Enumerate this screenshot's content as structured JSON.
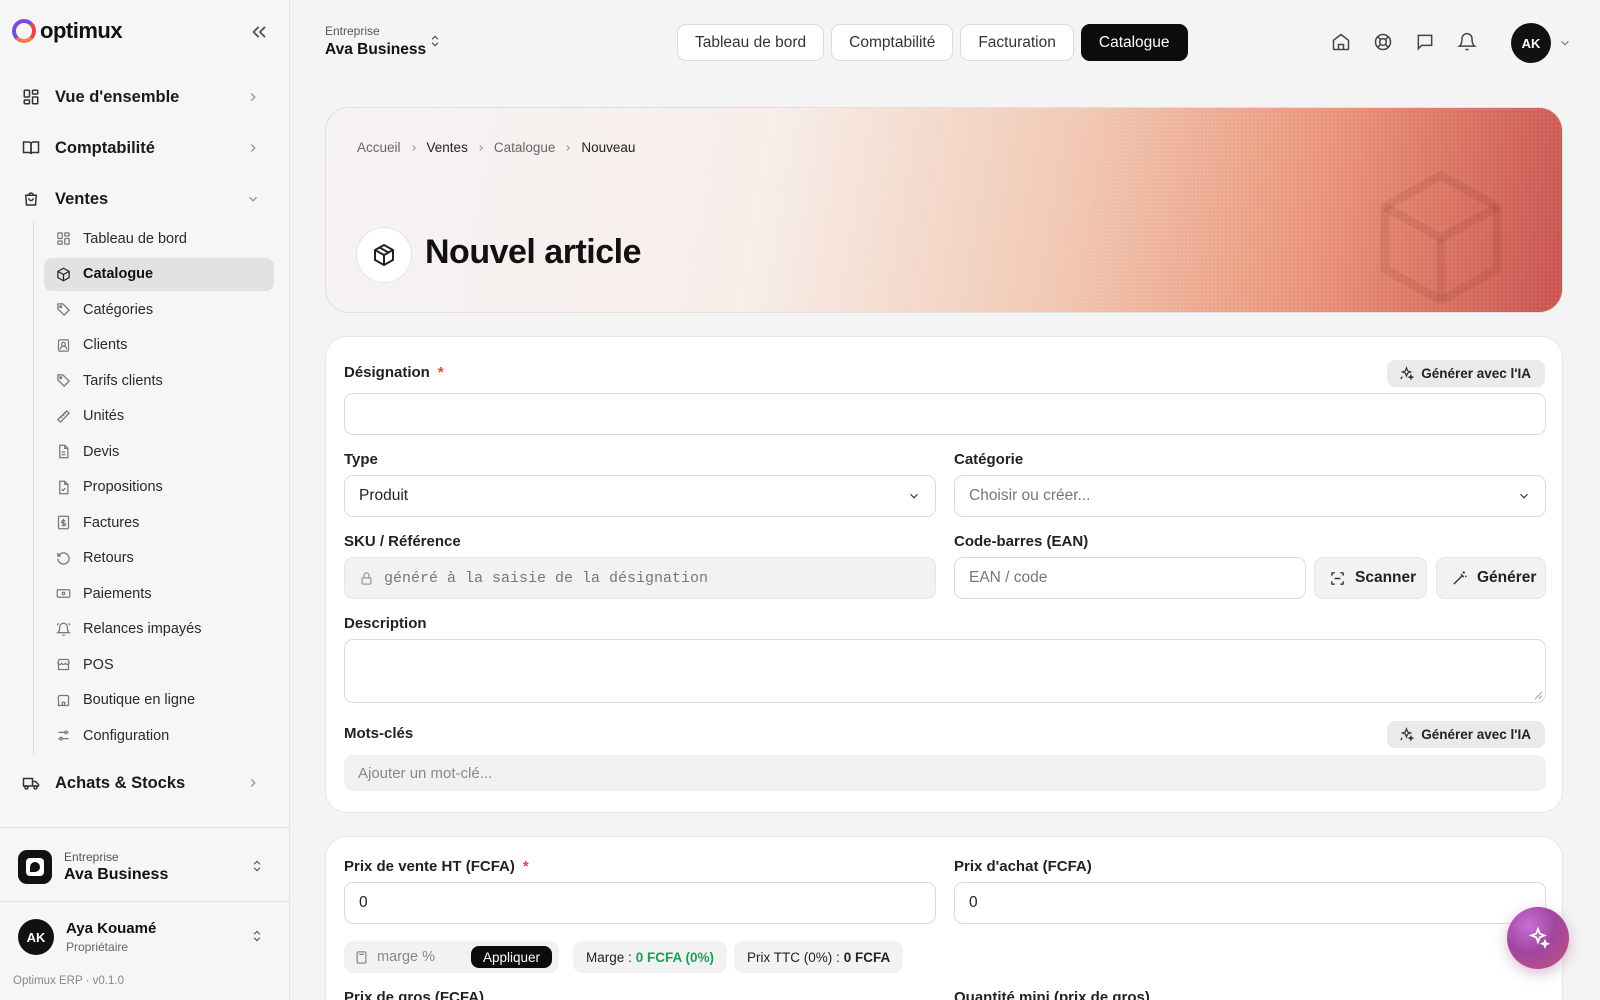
{
  "brand": {
    "name": "optimux"
  },
  "sidebar": {
    "sections": [
      {
        "label": "Vue d'ensemble",
        "icon": "layout-grid-icon"
      },
      {
        "label": "Comptabilité",
        "icon": "book-icon"
      },
      {
        "label": "Ventes",
        "icon": "shopping-bag-icon"
      },
      {
        "label": "Achats & Stocks",
        "icon": "truck-icon"
      }
    ],
    "sales_items": [
      {
        "label": "Tableau de bord",
        "icon": "layout-grid-icon"
      },
      {
        "label": "Catalogue",
        "icon": "box-icon",
        "active": true
      },
      {
        "label": "Catégories",
        "icon": "tag-icon"
      },
      {
        "label": "Clients",
        "icon": "contact-icon"
      },
      {
        "label": "Tarifs clients",
        "icon": "tag-icon"
      },
      {
        "label": "Unités",
        "icon": "ruler-icon"
      },
      {
        "label": "Devis",
        "icon": "file-text-icon"
      },
      {
        "label": "Propositions",
        "icon": "file-check-icon"
      },
      {
        "label": "Factures",
        "icon": "receipt-icon"
      },
      {
        "label": "Retours",
        "icon": "rotate-ccw-icon"
      },
      {
        "label": "Paiements",
        "icon": "banknote-icon"
      },
      {
        "label": "Relances impayés",
        "icon": "bell-ring-icon"
      },
      {
        "label": "POS",
        "icon": "store-icon"
      },
      {
        "label": "Boutique en ligne",
        "icon": "store-icon"
      },
      {
        "label": "Configuration",
        "icon": "sliders-icon"
      }
    ],
    "company": {
      "label": "Entreprise",
      "name": "Ava Business"
    },
    "user": {
      "initials": "AK",
      "name": "Aya Kouamé",
      "role": "Propriétaire"
    },
    "version": "Optimux ERP · v0.1.0"
  },
  "topbar": {
    "company_label": "Entreprise",
    "company_name": "Ava Business",
    "tabs": [
      {
        "label": "Tableau de bord",
        "active": false
      },
      {
        "label": "Comptabilité",
        "active": false
      },
      {
        "label": "Facturation",
        "active": false
      },
      {
        "label": "Catalogue",
        "active": true
      }
    ],
    "icons": [
      "home-icon",
      "help-circle-icon",
      "message-icon",
      "bell-icon"
    ],
    "avatar_initials": "AK"
  },
  "hero": {
    "breadcrumb": [
      "Accueil",
      "Ventes",
      "Catalogue",
      "Nouveau"
    ],
    "title": "Nouvel article"
  },
  "form": {
    "designation": {
      "label": "Désignation",
      "required": "*",
      "value": "",
      "ai_button": "Générer avec l'IA"
    },
    "type": {
      "label": "Type",
      "value": "Produit"
    },
    "category": {
      "label": "Catégorie",
      "placeholder": "Choisir ou créer..."
    },
    "sku": {
      "label": "SKU / Référence",
      "placeholder": "généré à la saisie de la désignation"
    },
    "barcode": {
      "label": "Code-barres (EAN)",
      "placeholder": "EAN / code",
      "scan_button": "Scanner",
      "generate_button": "Générer"
    },
    "description": {
      "label": "Description",
      "value": ""
    },
    "keywords": {
      "label": "Mots-clés",
      "placeholder": "Ajouter un mot-clé...",
      "ai_button": "Générer avec l'IA"
    }
  },
  "pricing": {
    "sale_price": {
      "label": "Prix de vente HT (FCFA)",
      "required": "*",
      "value": "0"
    },
    "purchase_price": {
      "label": "Prix d'achat (FCFA)",
      "value": "0"
    },
    "margin_input": {
      "placeholder": "marge %",
      "apply_button": "Appliquer"
    },
    "margin_summary": {
      "label": "Marge :",
      "value": "0 FCFA (0%)"
    },
    "ttc_summary": {
      "label": "Prix TTC (0%) :",
      "value": "0 FCFA"
    },
    "wholesale_price": {
      "label": "Prix de gros (FCFA)"
    },
    "min_quantity": {
      "label": "Quantité mini (prix de gros)"
    }
  },
  "colors": {
    "accent_dark": "#0c0c0c",
    "positive": "#1f9d55",
    "required": "#e0463e"
  }
}
